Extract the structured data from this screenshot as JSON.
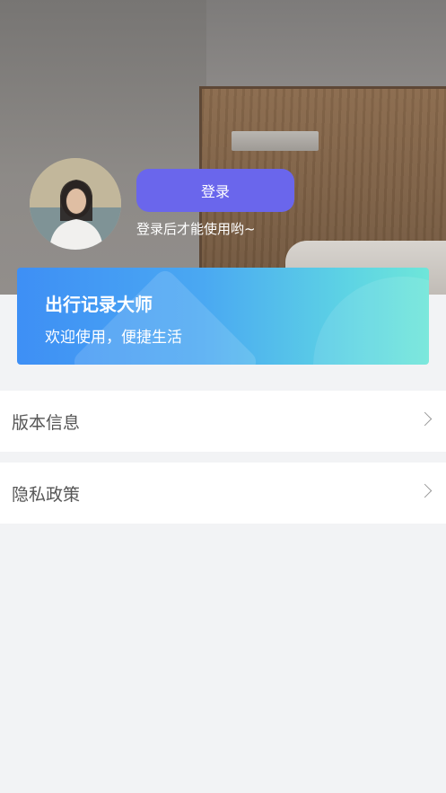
{
  "profile": {
    "login_label": "登录",
    "login_hint": "登录后才能使用哟~"
  },
  "banner": {
    "title": "出行记录大师",
    "subtitle": "欢迎使用，便捷生活"
  },
  "menu": {
    "items": [
      {
        "label": "版本信息",
        "icon": "chevron-right-icon"
      },
      {
        "label": "隐私政策",
        "icon": "chevron-right-icon"
      }
    ]
  },
  "colors": {
    "login_button": "#6a66ec",
    "banner_start": "#3e8ff5",
    "banner_end": "#6ee6d9",
    "page_background": "#f2f3f5"
  }
}
